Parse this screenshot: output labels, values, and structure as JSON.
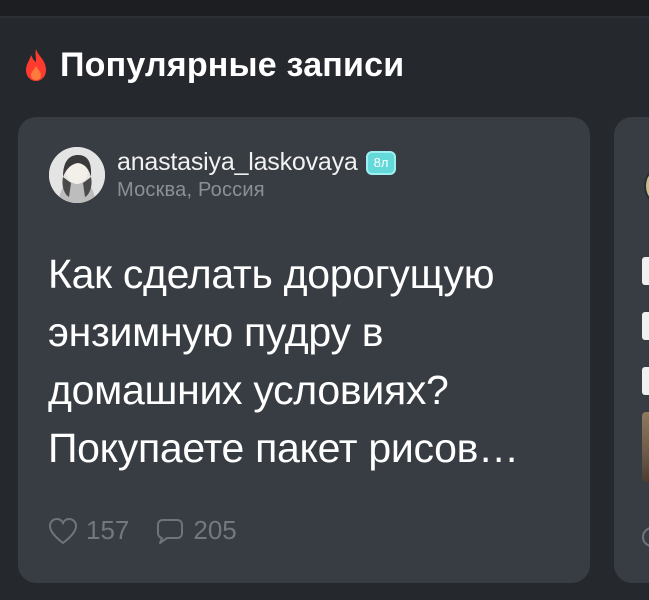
{
  "section": {
    "title": "Популярные записи",
    "icon": "fire-icon",
    "accent": "#ff3b30"
  },
  "post": {
    "author": {
      "username": "anastasiya_laskovaya",
      "level": "8л",
      "location": "Москва, Россия",
      "avatar": "avatar-photo"
    },
    "text": "Как сделать дорогущую энзимную пудру в домашних условиях? Покупаете пакет рисов…",
    "likes": "157",
    "comments": "205"
  },
  "colors": {
    "background": "#25282d",
    "card": "#383c43",
    "badge": "#64d9d9",
    "muted": "#727780"
  }
}
